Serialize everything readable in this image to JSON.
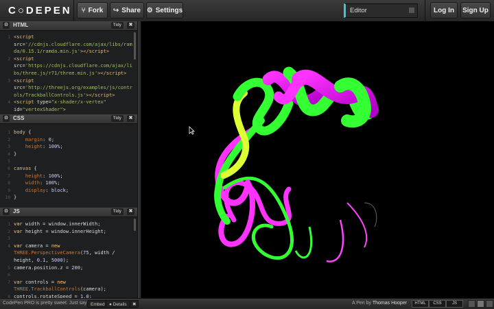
{
  "topbar": {
    "logo": "C○DEPEN",
    "fork": "Fork",
    "share": "Share",
    "settings": "Settings",
    "editor": "Editor",
    "login": "Log In",
    "signup": "Sign Up"
  },
  "panes": {
    "html": {
      "title": "HTML",
      "tidy": "Tidy",
      "close": "✖"
    },
    "css": {
      "title": "CSS",
      "tidy": "Tidy",
      "close": "✖"
    },
    "js": {
      "title": "JS",
      "tidy": "Tidy",
      "close": "✖"
    }
  },
  "html_lines": [
    {
      "n": "1",
      "html": "<span class='tag'>&lt;script</span>"
    },
    {
      "n": "",
      "html": "src=<span class='str'>'//cdnjs.cloudflare.com/ajax/libs/ram</span>"
    },
    {
      "n": "",
      "html": "<span class='str'>da/0.15.1/ramda.min.js'</span><span class='tag'>&gt;&lt;/script&gt;</span>"
    },
    {
      "n": "2",
      "html": "<span class='tag'>&lt;script</span>"
    },
    {
      "n": "",
      "html": "src=<span class='str'>'https://cdnjs.cloudflare.com/ajax/li</span>"
    },
    {
      "n": "",
      "html": "<span class='str'>bs/three.js/r71/three.min.js'</span><span class='tag'>&gt;&lt;/script&gt;</span>"
    },
    {
      "n": "3",
      "html": "<span class='tag'>&lt;script</span>"
    },
    {
      "n": "",
      "html": "src=<span class='str'>'http://threejs.org/examples/js/contr</span>"
    },
    {
      "n": "",
      "html": "<span class='str'>ols/TrackballControls.js'</span><span class='tag'>&gt;&lt;/script&gt;</span>"
    },
    {
      "n": "4",
      "html": "<span class='tag'>&lt;script</span> type=<span class='str'>\"x-shader/x-vertex\"</span>"
    },
    {
      "n": "",
      "html": "id=<span class='str'>\"vertexShader\"</span><span class='tag'>&gt;</span>"
    }
  ],
  "css_lines": [
    {
      "n": "1",
      "html": "<span class='tag'>body</span> {"
    },
    {
      "n": "2",
      "html": "    <span class='prop'>margin</span>: <span class='num'>0</span>;"
    },
    {
      "n": "3",
      "html": "    <span class='prop'>height</span>: <span class='num'>100%</span>;"
    },
    {
      "n": "4",
      "html": "}"
    },
    {
      "n": "5",
      "html": ""
    },
    {
      "n": "6",
      "html": "<span class='tag'>canvas</span> {"
    },
    {
      "n": "7",
      "html": "    <span class='prop'>height</span>: <span class='num'>100%</span>;"
    },
    {
      "n": "8",
      "html": "    <span class='prop'>width</span>: <span class='num'>100%</span>;"
    },
    {
      "n": "9",
      "html": "    <span class='prop'>display</span>: <span class='num'>block</span>;"
    },
    {
      "n": "10",
      "html": "}"
    }
  ],
  "js_lines": [
    {
      "n": "1",
      "html": "<span class='kw'>var</span> width = window.innerWidth;"
    },
    {
      "n": "2",
      "html": "<span class='kw'>var</span> height = window.innerHeight;"
    },
    {
      "n": "3",
      "html": ""
    },
    {
      "n": "4",
      "html": "<span class='kw'>var</span> camera = <span class='kw'>new</span>"
    },
    {
      "n": "",
      "html": "<span class='prop'>THREE.PerspectiveCamera</span>(<span class='num'>75</span>, width /"
    },
    {
      "n": "",
      "html": "height, <span class='num'>0.1</span>, <span class='num'>5000</span>);"
    },
    {
      "n": "5",
      "html": "camera.position.z = <span class='num'>200</span>;"
    },
    {
      "n": "6",
      "html": ""
    },
    {
      "n": "7",
      "html": "<span class='kw'>var</span> controls = <span class='kw'>new</span>"
    },
    {
      "n": "",
      "html": "<span class='prop'>THREE.TrackballControls</span>(camera);"
    },
    {
      "n": "8",
      "html": "controls.rotateSpeed = <span class='num'>1.0</span>;"
    }
  ],
  "bottombar": {
    "promo": "CodePen PRO is pretty sweet. Just saying.",
    "embed": "Embed",
    "details": "Details",
    "close": "✖",
    "credit_prefix": "A Pen by",
    "author": "Thomas Hooper",
    "view_html": "HTML",
    "view_css": "CSS",
    "view_js": "JS"
  }
}
